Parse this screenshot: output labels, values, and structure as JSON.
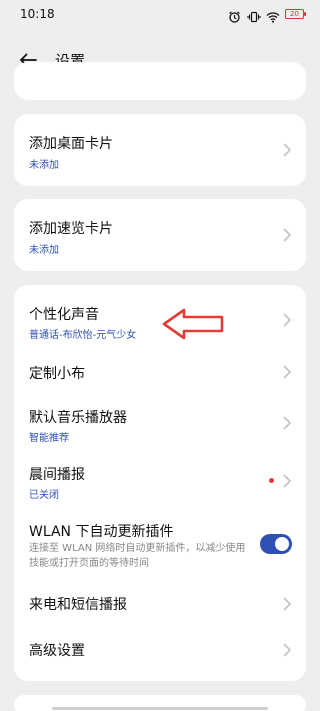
{
  "status_bar": {
    "time": "10:18",
    "battery": "20",
    "icons": [
      "alarm-icon",
      "vibrate-icon",
      "wifi-icon",
      "battery-icon"
    ]
  },
  "header": {
    "title": "设置",
    "back_icon": "back-arrow-icon"
  },
  "cards": [
    {
      "items": [
        {
          "title": "添加桌面卡片",
          "subtitle": "未添加"
        }
      ]
    },
    {
      "items": [
        {
          "title": "添加速览卡片",
          "subtitle": "未添加"
        }
      ]
    },
    {
      "items": [
        {
          "title": "个性化声音",
          "subtitle": "普通话-布欣怡-元气少女"
        },
        {
          "title": "定制小布"
        },
        {
          "title": "默认音乐播放器",
          "subtitle": "智能推荐"
        },
        {
          "title": "晨间播报",
          "subtitle": "已关闭",
          "dot": true
        },
        {
          "title": "WLAN 下自动更新插件",
          "description": "连接至 WLAN 网络时自动更新插件，以减少使用技能或打开页面的等待时间",
          "toggle_on": true
        },
        {
          "title": "来电和短信播报"
        },
        {
          "title": "高级设置"
        }
      ]
    }
  ],
  "annotation": {
    "color": "#e53935",
    "icon": "red-arrow-icon"
  },
  "colors": {
    "accent": "#2f50b5",
    "background": "#eeeef0",
    "card": "#ffffff"
  }
}
